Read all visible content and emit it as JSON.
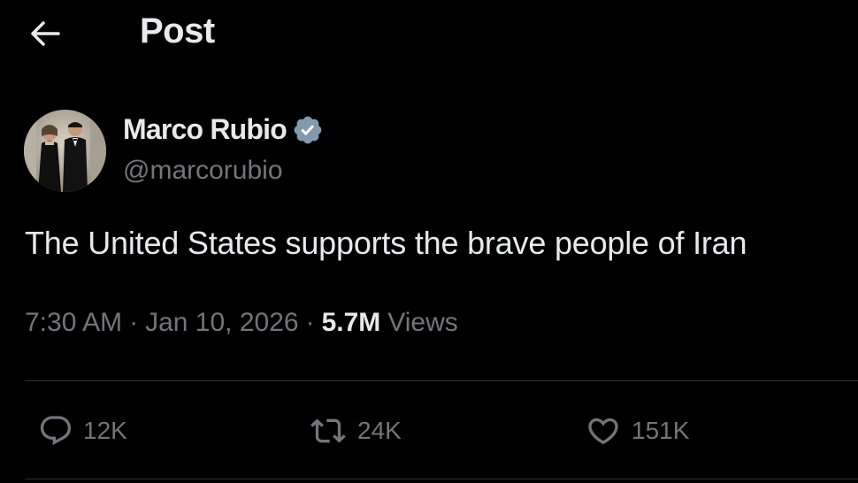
{
  "header": {
    "back_icon": "arrow-left-icon",
    "title": "Post"
  },
  "author": {
    "avatar_icon": "avatar-photo",
    "name": "Marco Rubio",
    "verified_icon": "verified-badge-icon",
    "verified_color": "#829aab",
    "handle": "@marcorubio"
  },
  "post": {
    "text": "The United States supports the brave people of Iran",
    "time": "7:30 AM",
    "separator": "·",
    "date": "Jan 10, 2026",
    "views_count": "5.7M",
    "views_label": "Views"
  },
  "actions": {
    "reply": {
      "icon": "reply-icon",
      "count": "12K"
    },
    "repost": {
      "icon": "repost-icon",
      "count": "24K"
    },
    "like": {
      "icon": "heart-icon",
      "count": "151K"
    }
  },
  "colors": {
    "background": "#000000",
    "text_primary": "#e7e9ea",
    "text_secondary": "#71767b",
    "divider": "#2f3336"
  }
}
